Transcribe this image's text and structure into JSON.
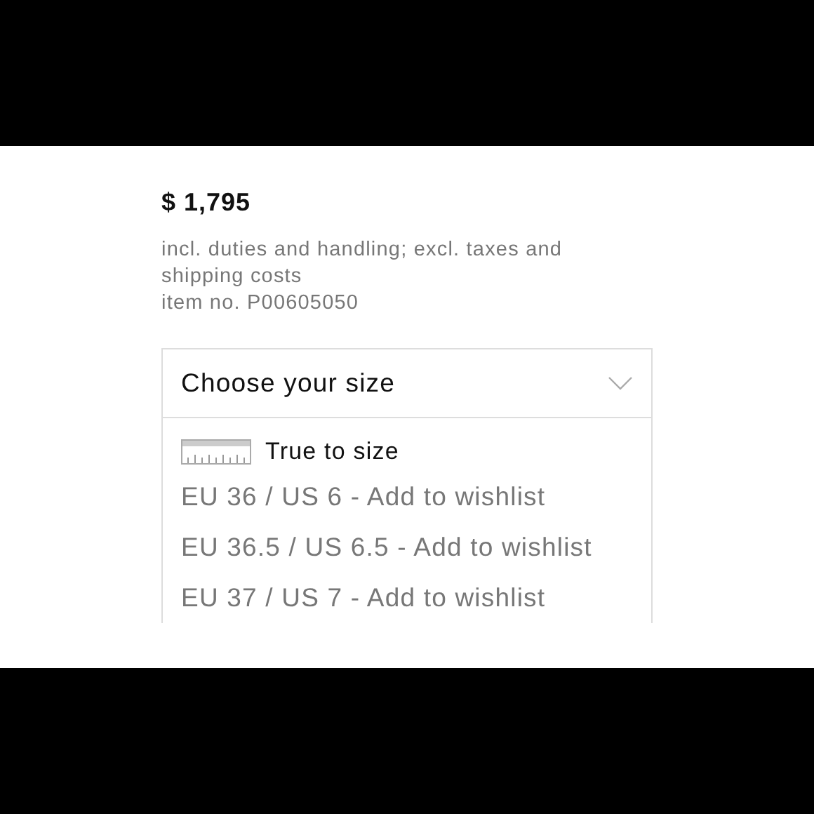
{
  "price": "$ 1,795",
  "price_note": "incl. duties and handling; excl. taxes and shipping costs",
  "item_number": "item no. P00605050",
  "size_select": {
    "label": "Choose your size",
    "expanded": true,
    "fit_note": "True to size",
    "options": [
      {
        "label": "EU 36 / US 6 - Add to wishlist"
      },
      {
        "label": "EU 36.5 / US 6.5 - Add to wishlist"
      },
      {
        "label": "EU 37 / US 7 - Add to wishlist"
      }
    ]
  }
}
